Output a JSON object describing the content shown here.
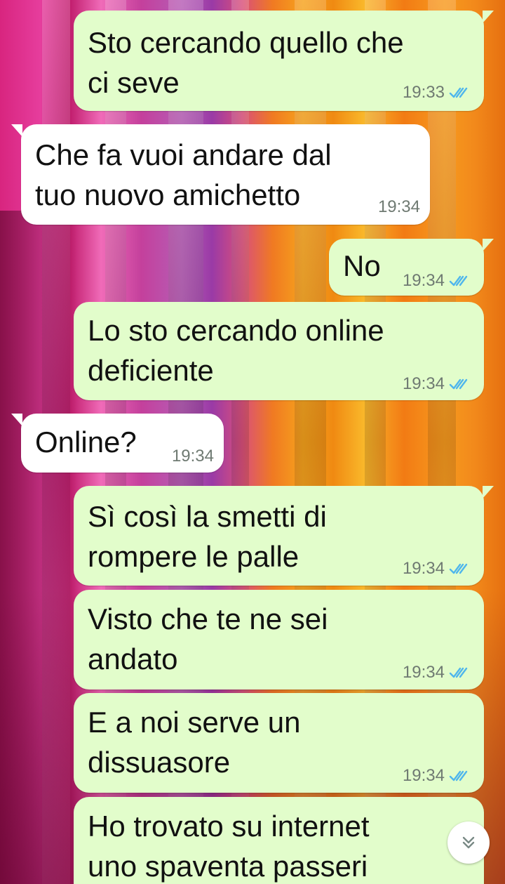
{
  "chat": {
    "messages": [
      {
        "direction": "out",
        "text": "Sto cercando quello che\nci seve",
        "time": "19:33",
        "read": true
      },
      {
        "direction": "in",
        "text": "Che fa vuoi andare dal\ntuo nuovo amichetto",
        "time": "19:34"
      },
      {
        "direction": "out",
        "text": "No",
        "time": "19:34",
        "read": true
      },
      {
        "direction": "out",
        "text": "Lo sto cercando online\ndeficiente",
        "time": "19:34",
        "read": true
      },
      {
        "direction": "in",
        "text": "Online?",
        "time": "19:34"
      },
      {
        "direction": "out",
        "text": "Sì così la smetti di\nrompere le palle",
        "time": "19:34",
        "read": true
      },
      {
        "direction": "out",
        "text": "Visto che te ne sei\nandato",
        "time": "19:34",
        "read": true
      },
      {
        "direction": "out",
        "text": "E a noi serve un\ndissuasore",
        "time": "19:34",
        "read": true
      },
      {
        "direction": "out",
        "text": "Ho trovato su internet\nuno spaventa passeri",
        "time": ""
      }
    ],
    "scroll_down_icon": "double-chevron-down-icon"
  },
  "colors": {
    "outgoing_bubble": "#e2fdcb",
    "incoming_bubble": "#ffffff",
    "read_tick": "#4fb6ec",
    "timestamp": "#6f7a72"
  }
}
